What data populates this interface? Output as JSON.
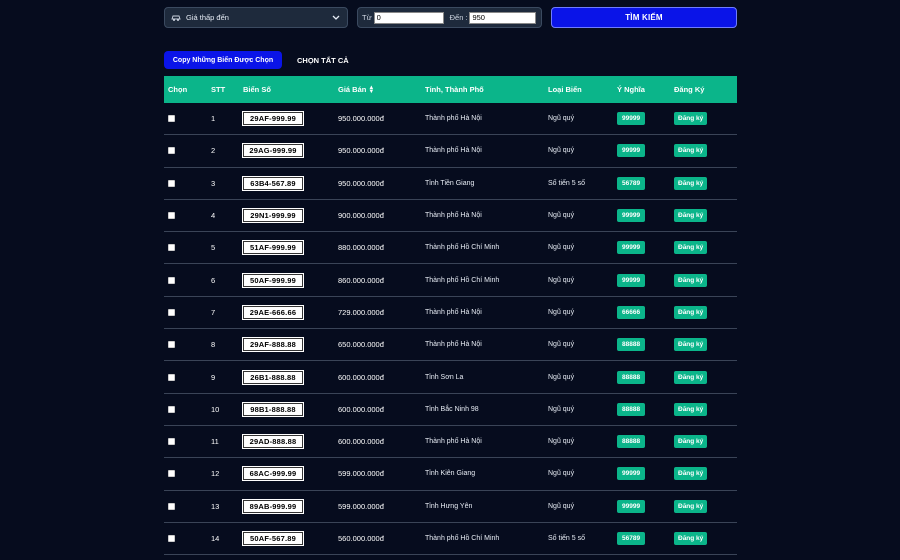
{
  "filters": {
    "sort_label": "Giá thấp đến",
    "from_label": "Từ",
    "from_value": "0",
    "to_label": "Đến",
    "to_value": "950",
    "search_label": "TÌM KIẾM"
  },
  "actions": {
    "copy_label": "Copy Những Biển Được Chọn",
    "select_all_label": "CHỌN TẤT CẢ"
  },
  "table": {
    "headers": {
      "select": "Chọn",
      "stt": "STT",
      "plate": "Biển Số",
      "price": "Giá Bán",
      "city": "Tỉnh, Thành Phố",
      "type": "Loại Biển",
      "meaning": "Ý Nghĩa",
      "register": "Đăng Ký"
    },
    "rows": [
      {
        "stt": "1",
        "plate": "29AF-999.99",
        "price": "950.000.000đ",
        "city": "Thành phố Hà Nội",
        "type": "Ngũ quý",
        "meaning": "99999",
        "register": "Đăng ký"
      },
      {
        "stt": "2",
        "plate": "29AG-999.99",
        "price": "950.000.000đ",
        "city": "Thành phố Hà Nội",
        "type": "Ngũ quý",
        "meaning": "99999",
        "register": "Đăng ký"
      },
      {
        "stt": "3",
        "plate": "63B4-567.89",
        "price": "950.000.000đ",
        "city": "Tỉnh Tiền Giang",
        "type": "Số tiến 5 số",
        "meaning": "56789",
        "register": "Đăng ký"
      },
      {
        "stt": "4",
        "plate": "29N1-999.99",
        "price": "900.000.000đ",
        "city": "Thành phố Hà Nội",
        "type": "Ngũ quý",
        "meaning": "99999",
        "register": "Đăng ký"
      },
      {
        "stt": "5",
        "plate": "51AF-999.99",
        "price": "880.000.000đ",
        "city": "Thành phố Hồ Chí Minh",
        "type": "Ngũ quý",
        "meaning": "99999",
        "register": "Đăng ký"
      },
      {
        "stt": "6",
        "plate": "50AF-999.99",
        "price": "860.000.000đ",
        "city": "Thành phố Hồ Chí Minh",
        "type": "Ngũ quý",
        "meaning": "99999",
        "register": "Đăng ký"
      },
      {
        "stt": "7",
        "plate": "29AE-666.66",
        "price": "729.000.000đ",
        "city": "Thành phố Hà Nội",
        "type": "Ngũ quý",
        "meaning": "66666",
        "register": "Đăng ký"
      },
      {
        "stt": "8",
        "plate": "29AF-888.88",
        "price": "650.000.000đ",
        "city": "Thành phố Hà Nội",
        "type": "Ngũ quý",
        "meaning": "88888",
        "register": "Đăng ký"
      },
      {
        "stt": "9",
        "plate": "26B1-888.88",
        "price": "600.000.000đ",
        "city": "Tỉnh Sơn La",
        "type": "Ngũ quý",
        "meaning": "88888",
        "register": "Đăng ký"
      },
      {
        "stt": "10",
        "plate": "98B1-888.88",
        "price": "600.000.000đ",
        "city": "Tỉnh Bắc Ninh 98",
        "type": "Ngũ quý",
        "meaning": "88888",
        "register": "Đăng ký"
      },
      {
        "stt": "11",
        "plate": "29AD-888.88",
        "price": "600.000.000đ",
        "city": "Thành phố Hà Nội",
        "type": "Ngũ quý",
        "meaning": "88888",
        "register": "Đăng ký"
      },
      {
        "stt": "12",
        "plate": "68AC-999.99",
        "price": "599.000.000đ",
        "city": "Tỉnh Kiên Giang",
        "type": "Ngũ quý",
        "meaning": "99999",
        "register": "Đăng ký"
      },
      {
        "stt": "13",
        "plate": "89AB-999.99",
        "price": "599.000.000đ",
        "city": "Tỉnh Hưng Yên",
        "type": "Ngũ quý",
        "meaning": "99999",
        "register": "Đăng ký"
      },
      {
        "stt": "14",
        "plate": "50AF-567.89",
        "price": "560.000.000đ",
        "city": "Thành phố Hồ Chí Minh",
        "type": "Số tiến 5 số",
        "meaning": "56789",
        "register": "Đăng ký"
      }
    ]
  },
  "colors": {
    "background": "#060c1e",
    "accent_blue": "#0a14e8",
    "accent_green": "#0bb58a"
  }
}
